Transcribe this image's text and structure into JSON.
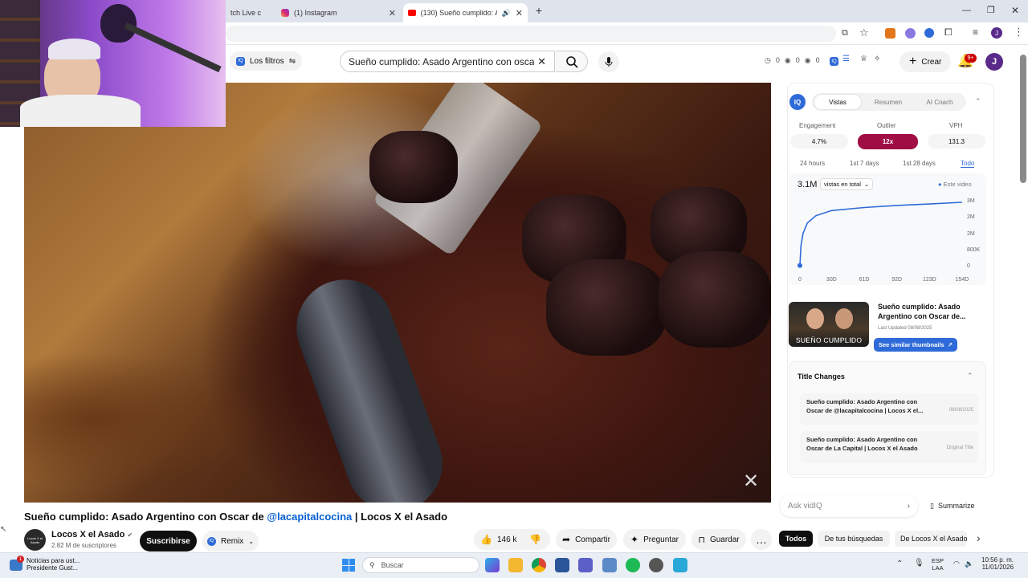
{
  "browser": {
    "tabs": [
      {
        "label": "tch Live c",
        "active": false
      },
      {
        "label": "(1) Instagram",
        "active": false
      },
      {
        "label": "(130) Sueño cumplido: Asa",
        "active": true
      }
    ],
    "new_tab_icon": "plus-icon"
  },
  "yt_header": {
    "filters_label": "Los filtros",
    "search_value": "Sueño cumplido: Asado Argentino con oscar de @l",
    "stats": [
      "0",
      "0",
      "0"
    ],
    "create_label": "Crear",
    "notif_badge": "9+",
    "avatar_letter": "J"
  },
  "video": {
    "title_prefix": "Sueño cumplido: Asado Argentino con Oscar de ",
    "title_link": "@lacapitalcocina",
    "title_suffix": " | Locos X el Asado"
  },
  "channel": {
    "name": "Locos X el Asado",
    "subscribers": "2.82 M de suscriptores",
    "subscribe_label": "Suscribirse",
    "remix_label": "Remix",
    "avatar_text": "Locos X el Asado"
  },
  "actions": {
    "likes": "146 k",
    "share": "Compartir",
    "ask": "Preguntar",
    "save": "Guardar"
  },
  "vidiq": {
    "tabs": [
      "Vistas",
      "Resumen",
      "AI Coach"
    ],
    "metrics": [
      {
        "label": "Engagement",
        "value": "4.7%"
      },
      {
        "label": "Outlier",
        "value": "12x"
      },
      {
        "label": "VPH",
        "value": "131.3"
      }
    ],
    "ranges": [
      "24 hours",
      "1st 7 days",
      "1st 28 days",
      "Todo"
    ],
    "total_views": "3.1M",
    "views_select": "vistas en total",
    "legend": "Este video",
    "thumb_title": "Sueño cumplido: Asado Argentino con Oscar de...",
    "thumb_text": "SUEÑO CUMPLIDO",
    "last_updated": "Last Updated 08/08/2025",
    "similar_btn": "See similar thumbnails",
    "title_changes_label": "Title Changes",
    "title_changes": [
      {
        "title": "Sueño cumplido: Asado Argentino con Oscar de @lacapitalcocina | Locos X el...",
        "date": "08/08/2025"
      },
      {
        "title": "Sueño cumplido: Asado Argentino con Oscar de La Capital | Locos X el Asado",
        "date": "Original Title"
      }
    ],
    "ask_placeholder": "Ask vidIQ",
    "summarize": "Summarize",
    "filter_chips": [
      "Todos",
      "De tus búsquedas",
      "De Locos X el Asado"
    ],
    "colors": {
      "accent": "#a00d44",
      "blue": "#2f6bd8"
    }
  },
  "chart_data": {
    "type": "line",
    "x_ticks": [
      "0",
      "30D",
      "61D",
      "92D",
      "123D",
      "154D"
    ],
    "y_ticks": [
      "3M",
      "2M",
      "2M",
      "800K",
      "0"
    ],
    "ylim": [
      0,
      3100000
    ],
    "series": [
      {
        "name": "Este video",
        "x": [
          0,
          1,
          3,
          7,
          15,
          30,
          61,
          92,
          123,
          154
        ],
        "values": [
          50000,
          1000000,
          1600000,
          2100000,
          2450000,
          2700000,
          2850000,
          2950000,
          3020000,
          3100000
        ]
      }
    ]
  },
  "taskbar": {
    "news_title": "Noticias para ust...",
    "news_sub": "Presidente Gust...",
    "search_placeholder": "Buscar",
    "lang": "ESP",
    "lang2": "LAA",
    "time": "10:56 p. m.",
    "date": "11/01/2026"
  }
}
